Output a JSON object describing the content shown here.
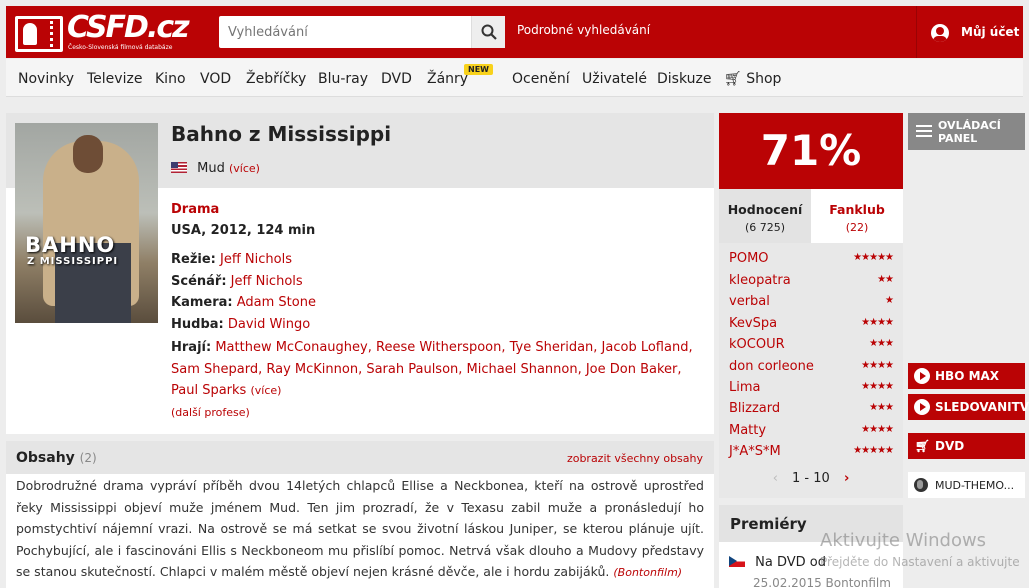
{
  "header": {
    "logo_text": "CSFD.cz",
    "logo_sub": "Česko-Slovenská filmová databáze",
    "search_placeholder": "Vyhledávání",
    "advanced_search": "Podrobné vyhledávání",
    "account": "Můj účet"
  },
  "nav": {
    "items": [
      "Novinky",
      "Televize",
      "Kino",
      "VOD",
      "Žebříčky",
      "Blu-ray",
      "DVD",
      "Žánry",
      "Ocenění",
      "Uživatelé",
      "Diskuze",
      "Shop"
    ],
    "new_badge": "NEW"
  },
  "film": {
    "title": "Bahno z Mississippi",
    "original_title": "Mud",
    "more": "(více)",
    "genre": "Drama",
    "country_year_length": "USA, 2012, 124 min",
    "poster_title": "BAHNO",
    "poster_title2": "Z MISSISSIPPI",
    "directing_label": "Režie:",
    "director": "Jeff Nichols",
    "screenplay_label": "Scénář:",
    "screenplay": "Jeff Nichols",
    "camera_label": "Kamera:",
    "camera": "Adam Stone",
    "music_label": "Hudba:",
    "music": "David Wingo",
    "cast_label": "Hrají:",
    "cast": "Matthew McConaughey, Reese Witherspoon, Tye Sheridan, Jacob Lofland, Sam Shepard, Ray McKinnon, Sarah Paulson, Michael Shannon, Joe Don Baker, Paul Sparks",
    "cast_more": "(více)",
    "other_professions": "(další profese)"
  },
  "content": {
    "title": "Obsahy",
    "count": "(2)",
    "show_all": "zobrazit všechny obsahy",
    "plot": "Dobrodružné drama vypráví příběh dvou 14letých chlapců Ellise a Neckbonea, kteří na ostrově uprostřed řeky Mississippi objeví muže jménem Mud. Ten jim prozradí, že v Texasu zabil muže a pronásledují ho pomstychtiví nájemní vrazi. Na ostrově se má setkat se svou životní láskou Juniper, se kterou plánuje ujít. Pochybující, ale i fascinováni Ellis s Neckboneom mu přislíbí pomoc. Netrvá však dlouho a Mudovy představy se stanou skutečností. Chlapci v malém městě objeví nejen krásné děvče, ale i hordu zabijáků.",
    "source": "(Bontonfilm)"
  },
  "rating": {
    "score": "71%",
    "tab_rating": "Hodnocení",
    "tab_rating_count": "(6 725)",
    "tab_fanclub": "Fanklub",
    "tab_fanclub_count": "(22)",
    "users": [
      {
        "name": "POMO",
        "stars": 5
      },
      {
        "name": "kleopatra",
        "stars": 2
      },
      {
        "name": "verbal",
        "stars": 1
      },
      {
        "name": "KevSpa",
        "stars": 4
      },
      {
        "name": "kOCOUR",
        "stars": 3
      },
      {
        "name": "don corleone",
        "stars": 4
      },
      {
        "name": "Lima",
        "stars": 4
      },
      {
        "name": "Blizzard",
        "stars": 3
      },
      {
        "name": "Matty",
        "stars": 4
      },
      {
        "name": "J*A*S*M",
        "stars": 5
      }
    ],
    "pager": "1 - 10"
  },
  "premieres": {
    "title": "Premiéry",
    "row": "Na DVD od",
    "date": "25.02.2015 Bontonfilm"
  },
  "sidebar": {
    "panel_button": "OVLÁDACÍ PANEL",
    "hbo": "HBO MAX",
    "sledovanitv": "SLEDOVANITV",
    "dvd": "DVD",
    "mud_link": "MUD-THEMO..."
  },
  "watermark": {
    "line1": "Aktivujte Windows",
    "line2": "Přejděte do Nastavení a aktivujte"
  },
  "colors": {
    "accent": "#ba0305",
    "badge": "#f8d21c"
  }
}
